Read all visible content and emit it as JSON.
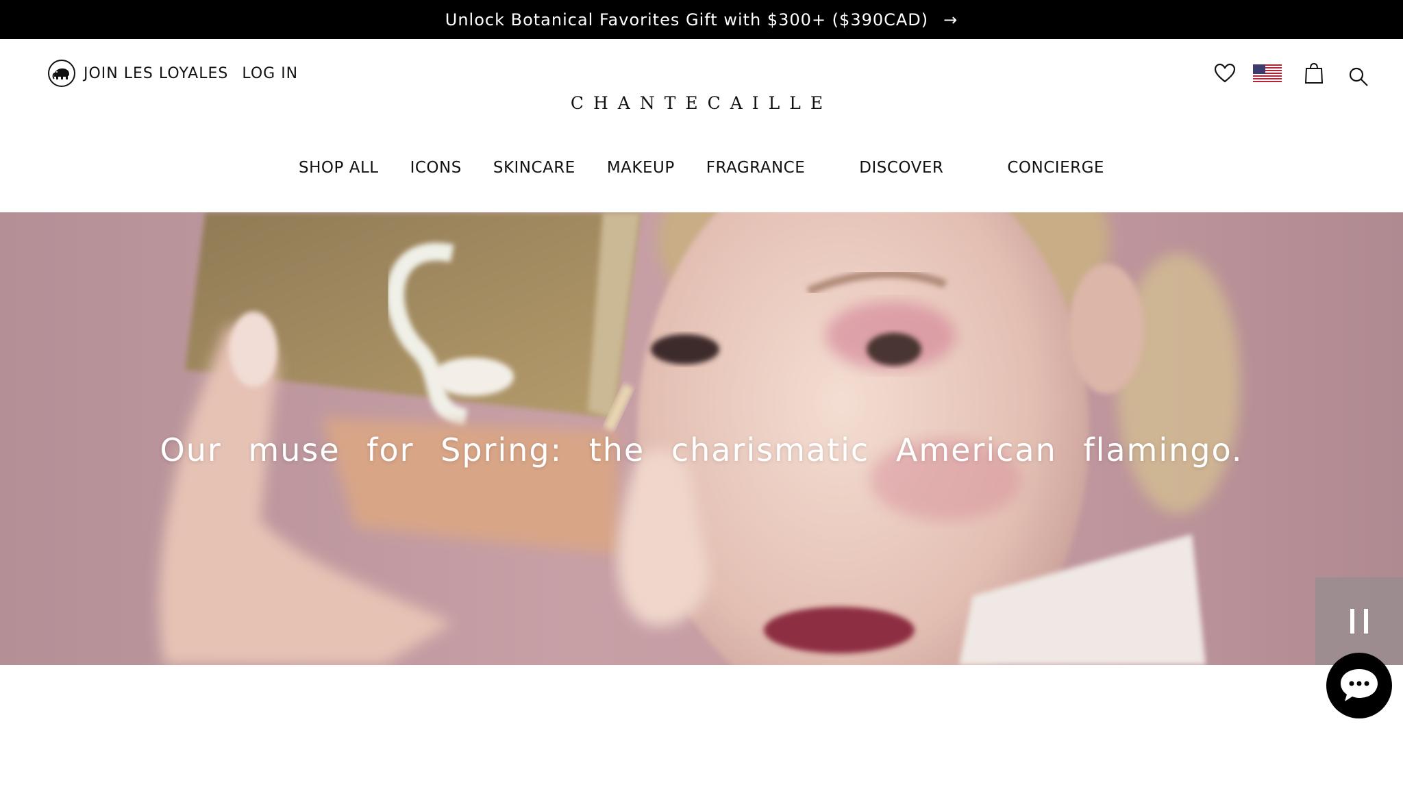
{
  "promo": {
    "text": "Unlock Botanical Favorites Gift with $300+ ($390CAD)",
    "arrow": "→"
  },
  "header": {
    "join_label": "JOIN LES LOYALES",
    "login_label": "LOG IN",
    "logo": "CHANTECAILLE",
    "icons": [
      "elephant-icon",
      "heart-icon",
      "us-flag-icon",
      "shopping-bag-icon",
      "search-icon"
    ]
  },
  "nav": {
    "items": [
      "SHOP ALL",
      "ICONS",
      "SKINCARE",
      "MAKEUP",
      "FRAGRANCE",
      "DISCOVER",
      "CONCIERGE"
    ]
  },
  "hero": {
    "tagline": "Our muse for Spring: the charismatic American flamingo.",
    "pause_icon": "pause-icon"
  },
  "chat": {
    "icon": "chat-bubble-icon"
  },
  "colors": {
    "promo_bg": "#000000",
    "hero_pink": "#c49aa1",
    "text": "#111111"
  }
}
